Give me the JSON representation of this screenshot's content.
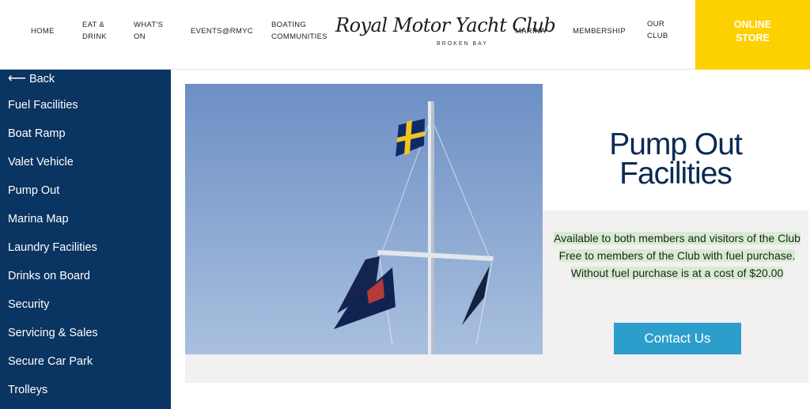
{
  "header": {
    "nav": [
      {
        "label": "HOME"
      },
      {
        "label": "EAT &\nDRINK"
      },
      {
        "label": "WHAT'S\nON"
      },
      {
        "label": "EVENTS@RMYC"
      },
      {
        "label": "BOATING\nCOMMUNITIES"
      },
      {
        "label": "MARINA"
      },
      {
        "label": "MEMBERSHIP"
      },
      {
        "label": "OUR\nCLUB"
      }
    ],
    "logo_text": "Royal Motor Yacht Club",
    "logo_sub": "BROKEN BAY",
    "store_label": "ONLINE\nSTORE"
  },
  "sidebar": {
    "back_label": "Back",
    "items": [
      {
        "label": "Fuel Facilities"
      },
      {
        "label": "Boat Ramp"
      },
      {
        "label": "Valet Vehicle"
      },
      {
        "label": "Pump Out"
      },
      {
        "label": "Marina Map"
      },
      {
        "label": "Laundry Facilities"
      },
      {
        "label": "Drinks on Board"
      },
      {
        "label": "Security"
      },
      {
        "label": "Servicing & Sales"
      },
      {
        "label": "Secure Car Park"
      },
      {
        "label": "Trolleys"
      }
    ]
  },
  "main": {
    "title": "Pump Out\nFacilities",
    "description": "Available to both members and visitors of the Club Free to members of the Club with fuel purchase. Without fuel purchase is at a cost of $20.00",
    "contact_label": "Contact Us"
  },
  "colors": {
    "sidebar_bg": "#0a3461",
    "store_bg": "#fdd000",
    "contact_bg": "#2c9ecb",
    "title_color": "#0a2a52",
    "highlight": "#d5ecd0"
  }
}
